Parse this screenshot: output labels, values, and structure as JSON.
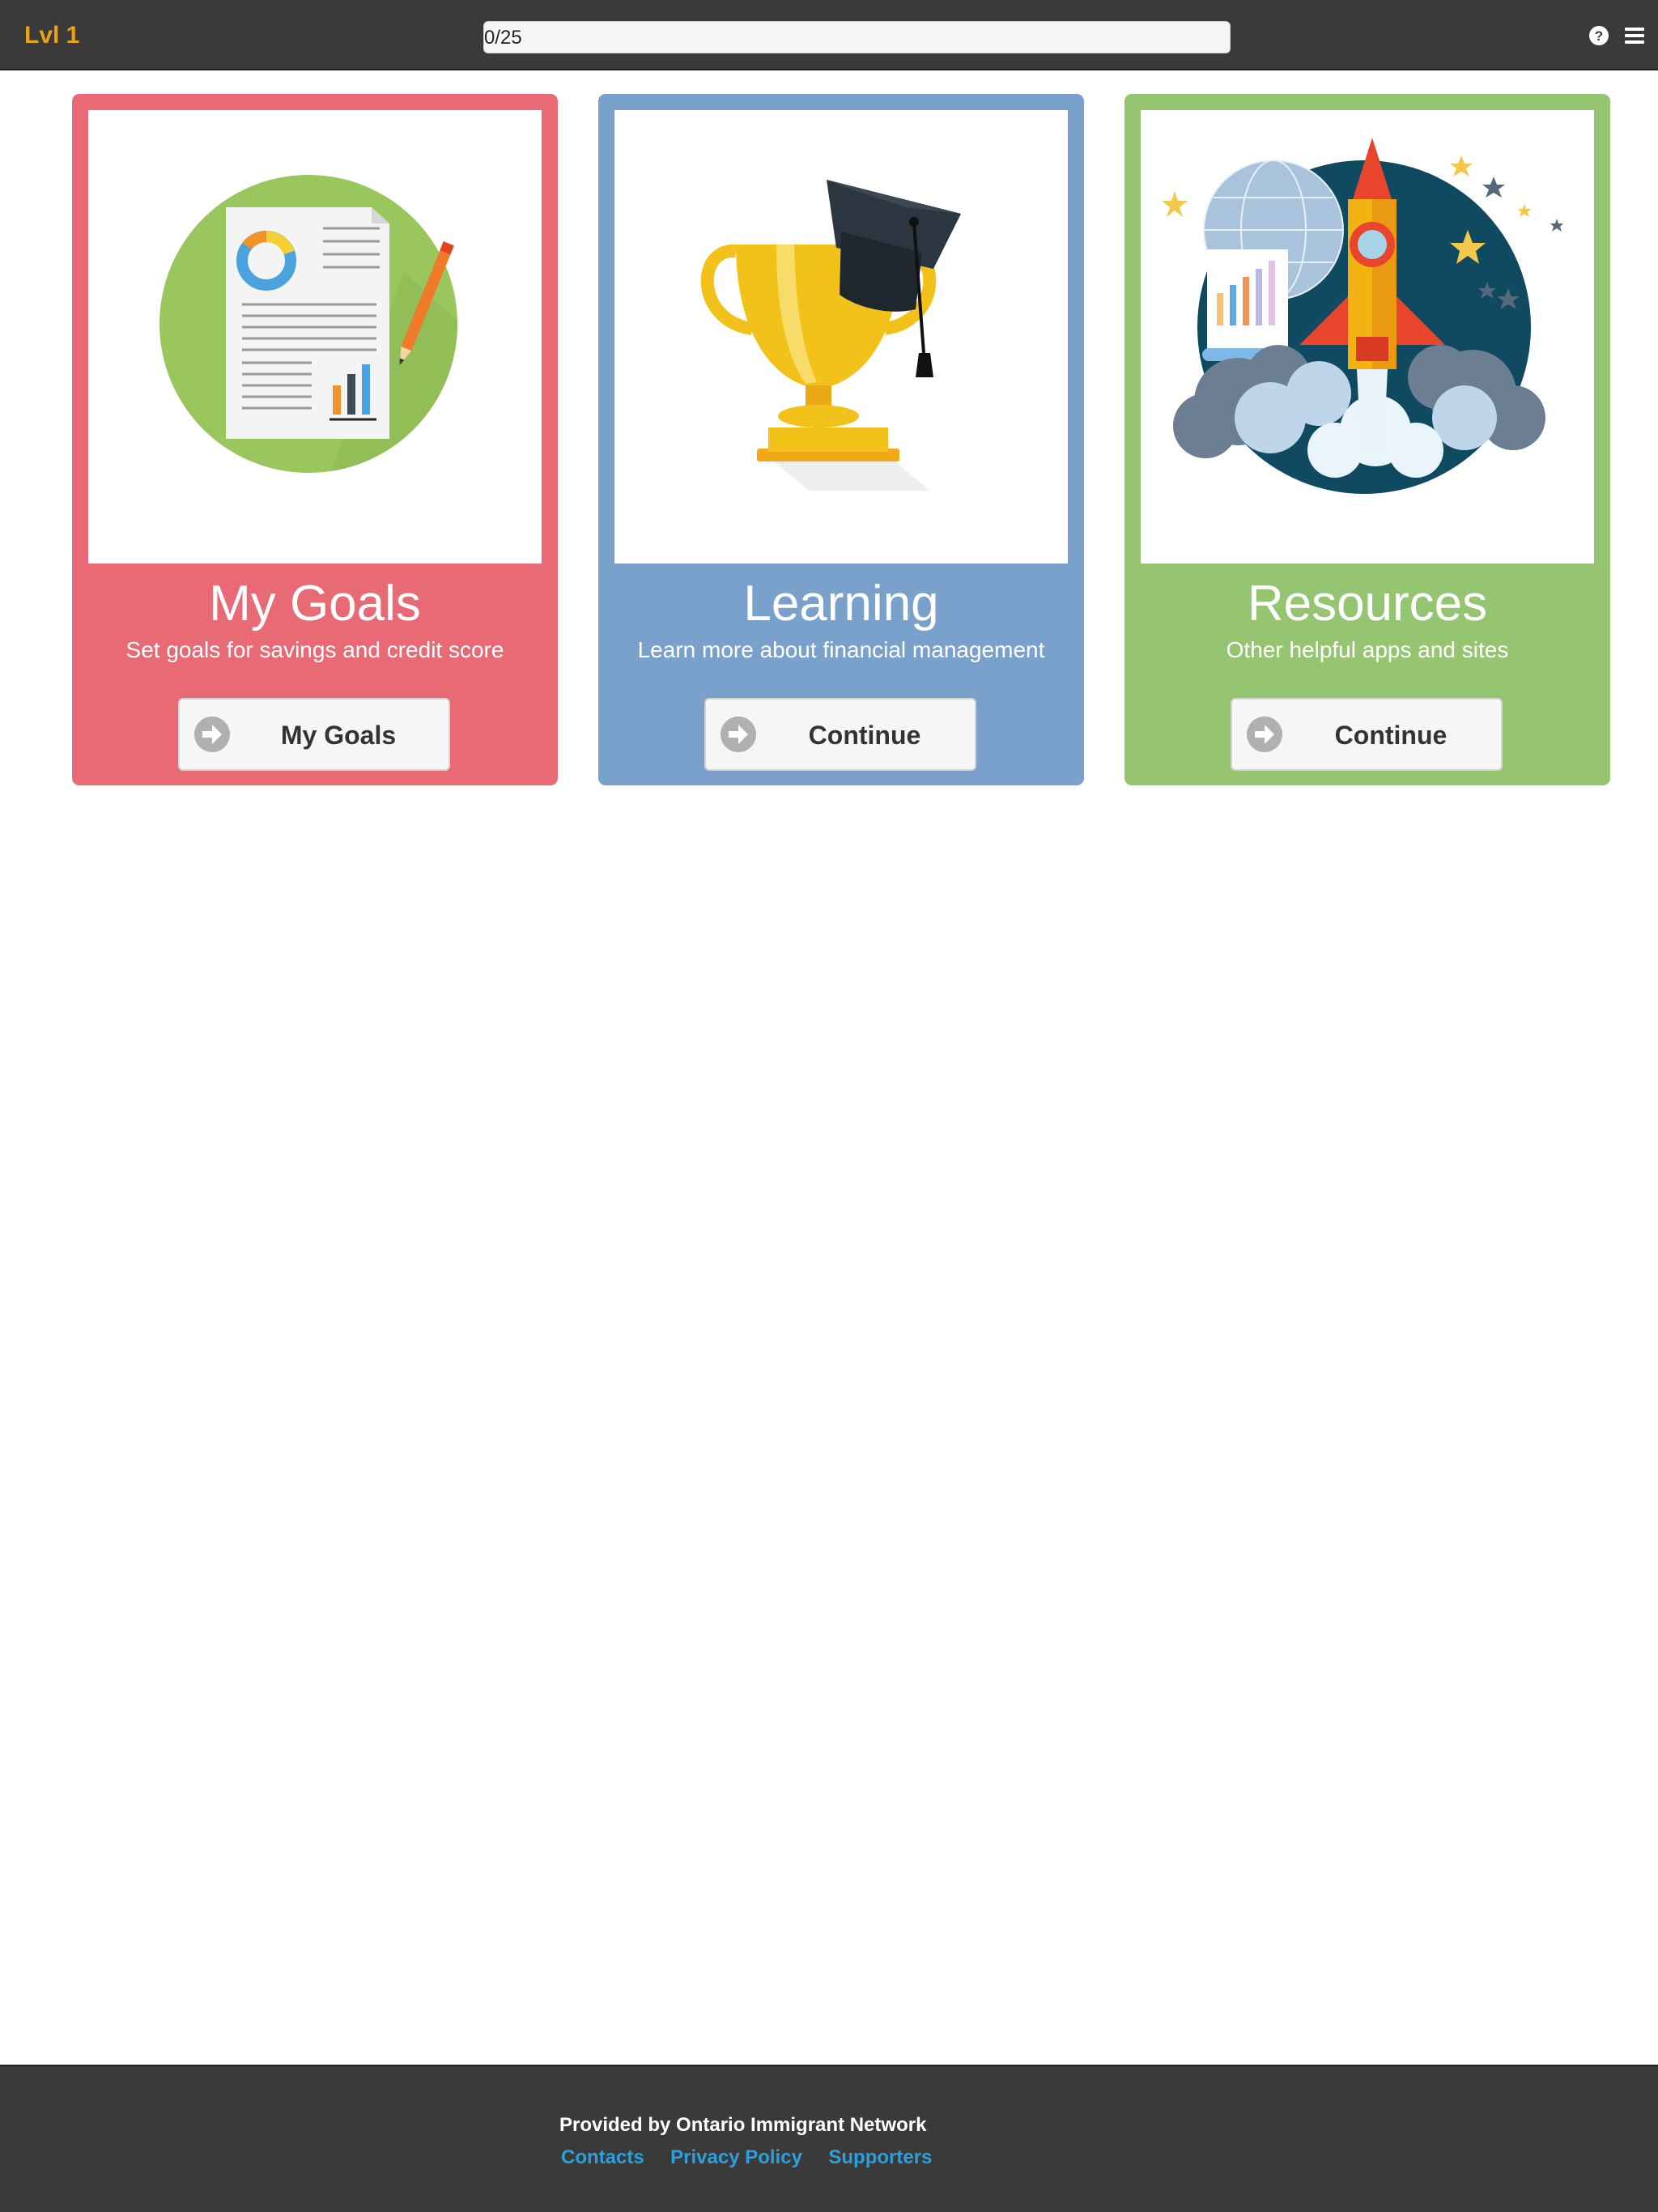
{
  "header": {
    "level": "Lvl 1",
    "progress": {
      "text": "0/25",
      "value": 0,
      "max": 25
    },
    "icons": [
      "question-circle-icon",
      "hamburger-menu-icon"
    ]
  },
  "cards": [
    {
      "title": "My Goals",
      "description": "Set goals for savings and credit score",
      "button": "My Goals",
      "color": "#e86a75",
      "image": "document-with-charts-illustration"
    },
    {
      "title": "Learning",
      "description": "Learn more about financial management",
      "button": "Continue",
      "color": "#7aa0cc",
      "image": "trophy-with-graduation-cap-illustration"
    },
    {
      "title": "Resources",
      "description": "Other helpful apps and sites",
      "button": "Continue",
      "color": "#96c572",
      "image": "rocket-launch-illustration"
    }
  ],
  "footer": {
    "provided_by": "Provided by Ontario Immigrant Network",
    "links": [
      "Contacts",
      "Privacy Policy",
      "Supporters"
    ],
    "link_color": "#2aa0df"
  },
  "colors": {
    "bar": "#3a3a3a",
    "accent": "#e8a416"
  }
}
